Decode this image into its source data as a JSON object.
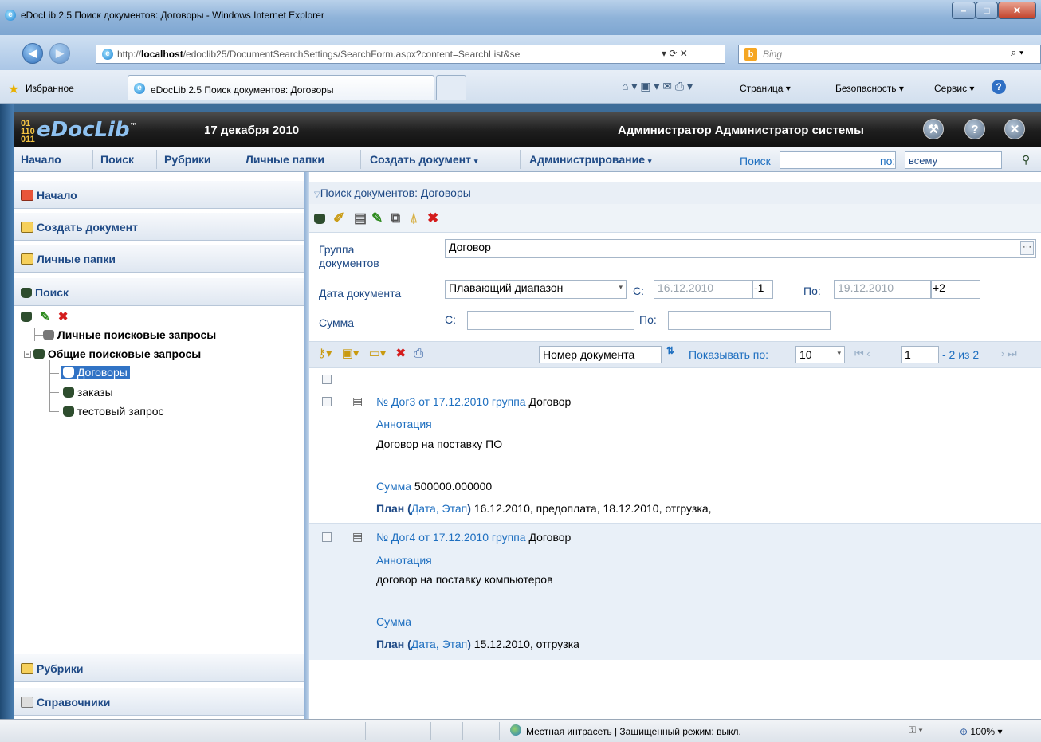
{
  "window": {
    "title": "eDocLib 2.5 Поиск документов: Договоры - Windows Internet Explorer"
  },
  "address": {
    "url_prefix": "http://",
    "url_host": "localhost",
    "url_rest": "/edoclib25/DocumentSearchSettings/SearchForm.aspx?content=SearchList&se",
    "search_engine": "Bing"
  },
  "favbar": {
    "favorites": "Избранное",
    "tab_title": "eDocLib 2.5 Поиск документов: Договоры",
    "page": "Страница ▾",
    "security": "Безопасность ▾",
    "tools": "Сервис ▾"
  },
  "app": {
    "logo": "eDocLib",
    "logo_tm": "™",
    "date": "17 декабря 2010",
    "user": "Администратор Администратор системы"
  },
  "menu": {
    "items": [
      "Начало",
      "Поиск",
      "Рубрики",
      "Личные папки",
      "Создать документ",
      "Администрирование"
    ],
    "search_label": "Поиск",
    "scope_label": "по:",
    "scope_value": "всему"
  },
  "sidebar": {
    "home": "Начало",
    "create": "Создать документ",
    "folders": "Личные папки",
    "search": "Поиск",
    "tree": {
      "personal": "Личные поисковые запросы",
      "common": "Общие поисковые запросы",
      "items": [
        "Договоры",
        "заказы",
        "тестовый запрос"
      ]
    },
    "rubrics": "Рубрики",
    "references": "Справочники"
  },
  "main": {
    "title": "Поиск документов: Договоры",
    "form": {
      "group_label_1": "Группа",
      "group_label_2": "документов",
      "group_value": "Договор",
      "date_label": "Дата документа",
      "date_mode": "Плавающий диапазон",
      "from_label": "С:",
      "date_from": "16.12.2010",
      "offset_from": "-1",
      "to_label": "По:",
      "date_to": "19.12.2010",
      "offset_to": "+2",
      "sum_label": "Сумма",
      "sum_from_label": "С:",
      "sum_to_label": "По:"
    },
    "results_toolbar": {
      "sort_field": "Номер документа",
      "show_by_label": "Показывать по:",
      "page_size": "10",
      "page": "1",
      "range": "- 2 из 2"
    },
    "results": [
      {
        "num": "№ Дог3",
        "from": "от 17.12.2010",
        "group_label": "группа",
        "group": "Договор",
        "annot_label": "Аннотация",
        "annot": "Договор на поставку ПО",
        "sum_label": "Сумма",
        "sum": "500000.000000",
        "plan_label": "План",
        "plan_open": "(",
        "plan_fields": "Дата, Этап",
        "plan_close": ")",
        "plan": "16.12.2010, предоплата, 18.12.2010, отгрузка,"
      },
      {
        "num": "№ Дог4",
        "from": "от 17.12.2010",
        "group_label": "группа",
        "group": "Договор",
        "annot_label": "Аннотация",
        "annot": "договор на поставку компьютеров",
        "sum_label": "Сумма",
        "sum": "",
        "plan_label": "План",
        "plan_open": "(",
        "plan_fields": "Дата, Этап",
        "plan_close": ")",
        "plan": "15.12.2010, отгрузка"
      }
    ]
  },
  "status": {
    "zone": "Местная интрасеть | Защищенный режим: выкл.",
    "zoom": "100%"
  },
  "colors": {
    "link": "#1e6fc0",
    "menu_text": "#1f4a86",
    "header_bg": "#1e1e1e"
  }
}
